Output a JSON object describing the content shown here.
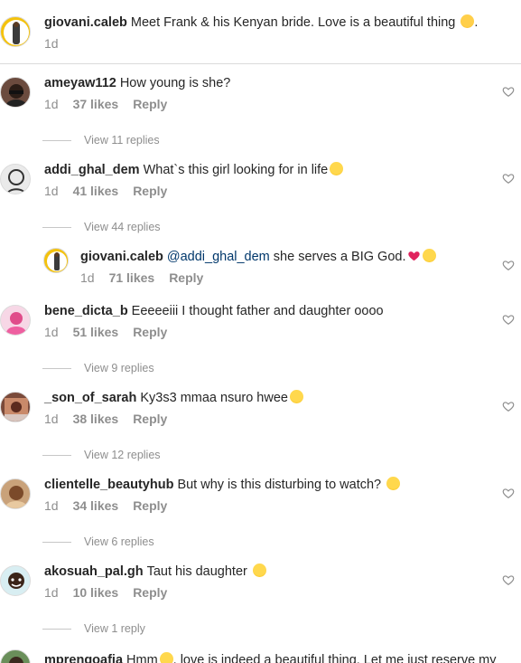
{
  "caption": {
    "username": "giovani.caleb",
    "text": "Meet Frank & his Kenyan bride. Love is a beautiful thing",
    "emoji": "heart-eyes-emoji",
    "punct": ".",
    "time": "1d"
  },
  "comments": [
    {
      "username": "ameyaw112",
      "text": "How young is she?",
      "time": "1d",
      "likes": "37 likes",
      "reply": "Reply",
      "view_replies": "View 11 replies"
    },
    {
      "username": "addi_ghal_dem",
      "text": "What`s this girl looking for in life",
      "time": "1d",
      "likes": "41 likes",
      "reply": "Reply",
      "view_replies": "View 44 replies"
    },
    {
      "username": "bene_dicta_b",
      "text": "Eeeeeiii I thought father and daughter oooo",
      "time": "1d",
      "likes": "51 likes",
      "reply": "Reply",
      "view_replies": "View 9 replies"
    },
    {
      "username": "_son_of_sarah",
      "text": "Ky3s3 mmaa nsuro hwee",
      "time": "1d",
      "likes": "38 likes",
      "reply": "Reply",
      "view_replies": "View 12 replies"
    },
    {
      "username": "clientelle_beautyhub",
      "text": "But why is this disturbing to watch?",
      "time": "1d",
      "likes": "34 likes",
      "reply": "Reply",
      "view_replies": "View 6 replies"
    },
    {
      "username": "akosuah_pal.gh",
      "text": "Taut his daughter",
      "time": "1d",
      "likes": "10 likes",
      "reply": "Reply",
      "view_replies": "View 1 reply"
    },
    {
      "username": "mprengoafia",
      "text": "Hmm",
      "text2": ", love is indeed a beautiful thing. Let me just reserve my"
    }
  ],
  "reply": {
    "username": "giovani.caleb",
    "mention": "@addi_ghal_dem",
    "text": "she serves a BIG God.",
    "time": "1d",
    "likes": "71 likes",
    "reply": "Reply"
  },
  "colors": {
    "text": "#262626",
    "muted": "#8e8e8e",
    "mention": "#00376b",
    "divider": "#dbdbdb"
  }
}
